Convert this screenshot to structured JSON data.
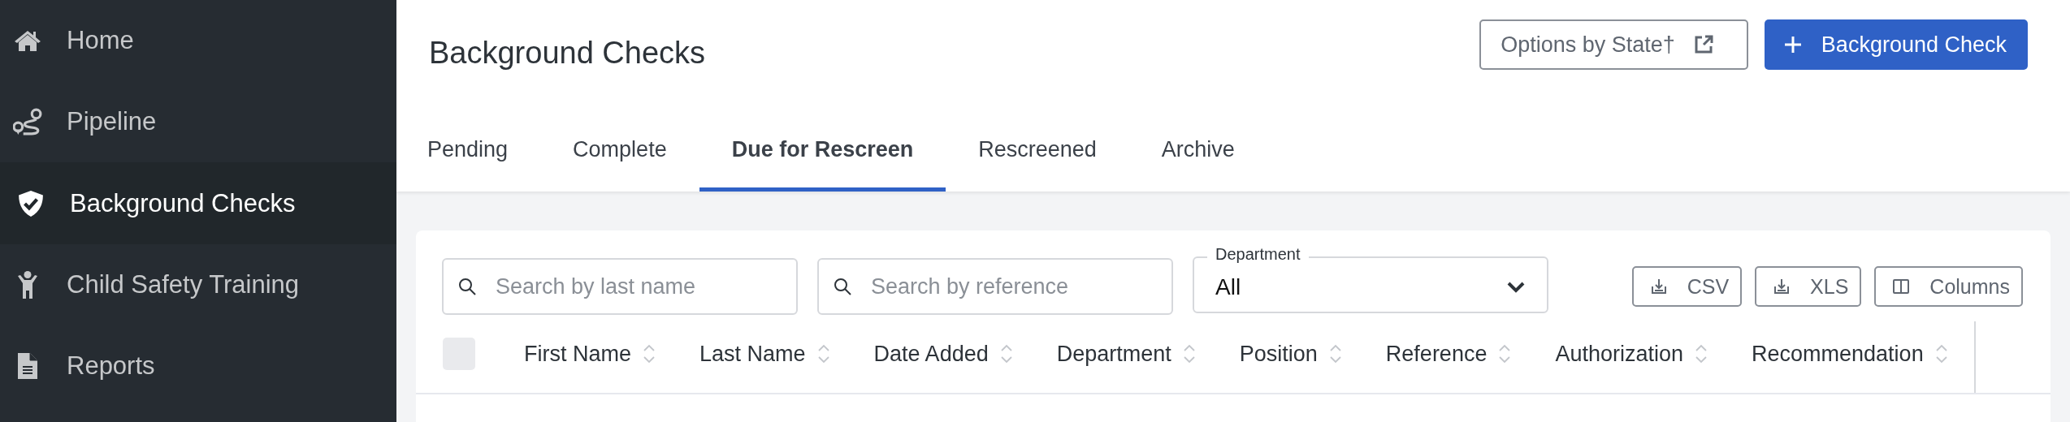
{
  "sidebar": {
    "items": [
      {
        "label": "Home",
        "selected": false
      },
      {
        "label": "Pipeline",
        "selected": false
      },
      {
        "label": "Background Checks",
        "selected": true
      },
      {
        "label": "Child Safety Training",
        "selected": false
      },
      {
        "label": "Reports",
        "selected": false
      }
    ]
  },
  "header": {
    "title": "Background Checks",
    "buttons": [
      {
        "label": "Options by State†",
        "kind": "outline"
      },
      {
        "label": "Background Check",
        "kind": "primary"
      }
    ]
  },
  "tabs": [
    {
      "label": "Pending",
      "selected": false
    },
    {
      "label": "Complete",
      "selected": false
    },
    {
      "label": "Due for Rescreen",
      "selected": true
    },
    {
      "label": "Rescreened",
      "selected": false
    },
    {
      "label": "Archive",
      "selected": false
    }
  ],
  "filters": {
    "search_fields": [
      {
        "placeholder": "Search by last name"
      },
      {
        "placeholder": "Search by reference"
      }
    ],
    "department": {
      "label": "Department",
      "value": "All"
    },
    "export_buttons": [
      "CSV",
      "XLS",
      "Columns"
    ]
  },
  "table": {
    "select_all": {
      "checked": false
    },
    "columns": [
      "First Name",
      "Last Name",
      "Date Added",
      "Department",
      "Position",
      "Reference",
      "Authorization",
      "Recommendation"
    ]
  }
}
